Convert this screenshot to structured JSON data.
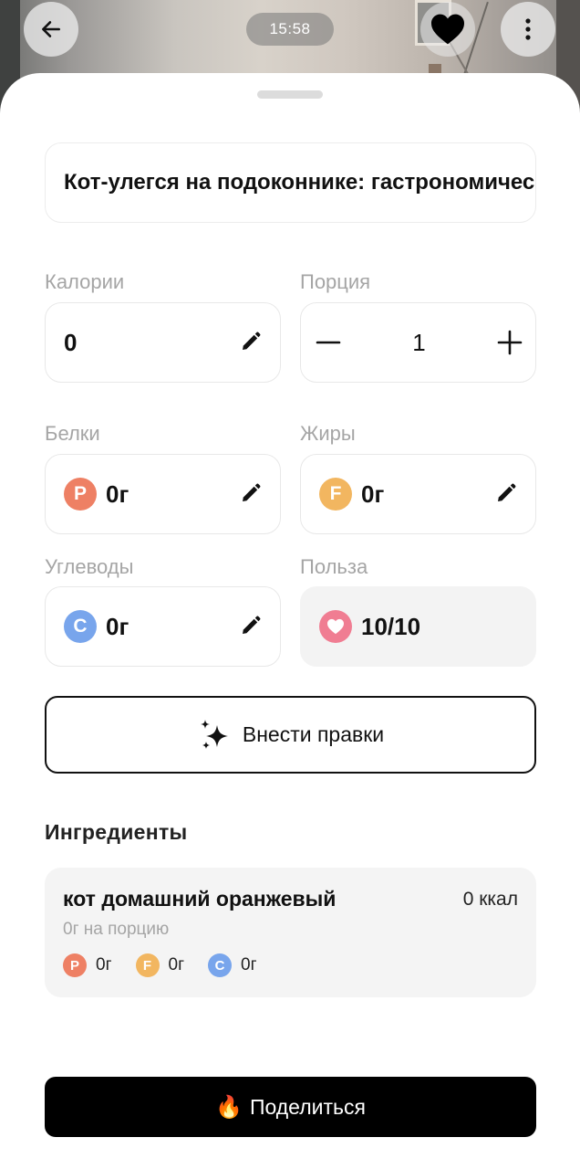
{
  "header": {
    "time": "15:58",
    "back_icon": "arrow-left-icon",
    "favorite_icon": "heart-icon",
    "more_icon": "more-vertical-icon"
  },
  "title": "Кот-улегся на подоконнике: гастрономический",
  "fields": {
    "calories": {
      "label": "Калории",
      "value": "0"
    },
    "portion": {
      "label": "Порция",
      "value": "1"
    },
    "protein": {
      "label": "Белки",
      "badge": "P",
      "value": "0г"
    },
    "fat": {
      "label": "Жиры",
      "badge": "F",
      "value": "0г"
    },
    "carbs": {
      "label": "Углеводы",
      "badge": "C",
      "value": "0г"
    },
    "benefit": {
      "label": "Польза",
      "value": "10/10"
    }
  },
  "edit_button": {
    "label": "Внести правки"
  },
  "ingredients": {
    "title": "Ингредиенты",
    "items": [
      {
        "name": "кот домашний оранжевый",
        "kcal": "0 ккал",
        "portion": "0г на порцию",
        "protein": "0г",
        "fat": "0г",
        "carbs": "0г",
        "badge_p": "P",
        "badge_f": "F",
        "badge_c": "C"
      }
    ]
  },
  "share_button": {
    "emoji": "🔥",
    "label": "Поделиться"
  },
  "colors": {
    "protein": "#ee8064",
    "fat": "#f2b660",
    "carbs": "#78a5ec",
    "benefit": "#f07d92"
  }
}
